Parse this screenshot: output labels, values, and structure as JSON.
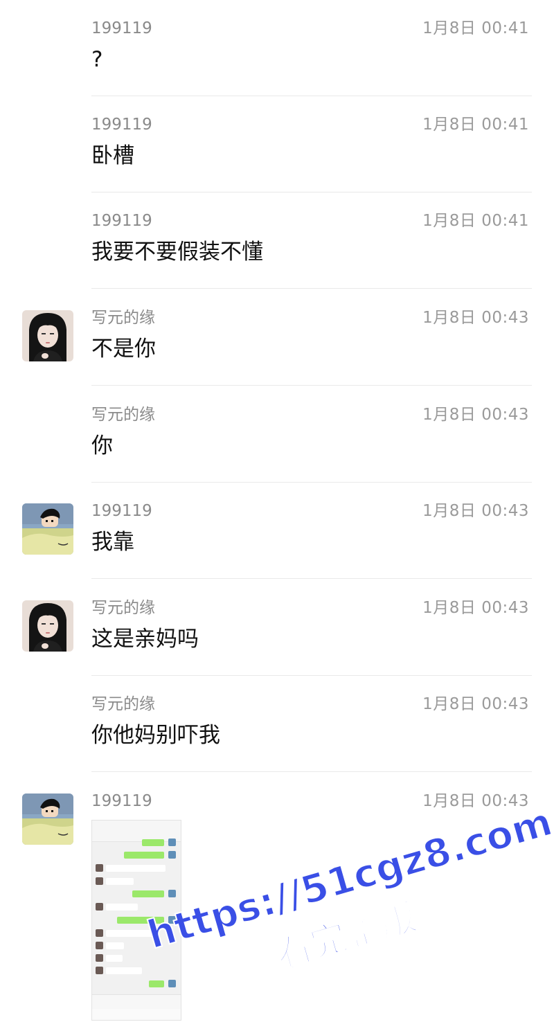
{
  "messages": [
    {
      "sender": "199119",
      "time": "1月8日 00:41",
      "text": "?"
    },
    {
      "sender": "199119",
      "time": "1月8日 00:41",
      "text": "卧槽"
    },
    {
      "sender": "199119",
      "time": "1月8日 00:41",
      "text": "我要不要假装不懂"
    },
    {
      "sender": "写元的缘",
      "time": "1月8日 00:43",
      "text": "不是你"
    },
    {
      "sender": "写元的缘",
      "time": "1月8日 00:43",
      "text": "你"
    },
    {
      "sender": "199119",
      "time": "1月8日 00:43",
      "text": "我靠"
    },
    {
      "sender": "写元的缘",
      "time": "1月8日 00:43",
      "text": "这是亲妈吗"
    },
    {
      "sender": "写元的缘",
      "time": "1月8日 00:43",
      "text": "你他妈别吓我"
    },
    {
      "sender": "199119",
      "time": "1月8日 00:43",
      "text": ""
    }
  ],
  "avatars": {
    "girl": "girl-avatar",
    "cartoon": "cartoon-avatar"
  },
  "image_message": {
    "type": "screenshot-thumbnail"
  },
  "watermark": {
    "line1": "https://51cgz8.com",
    "line2": "看完整版",
    "color": "#3a4fe6"
  }
}
